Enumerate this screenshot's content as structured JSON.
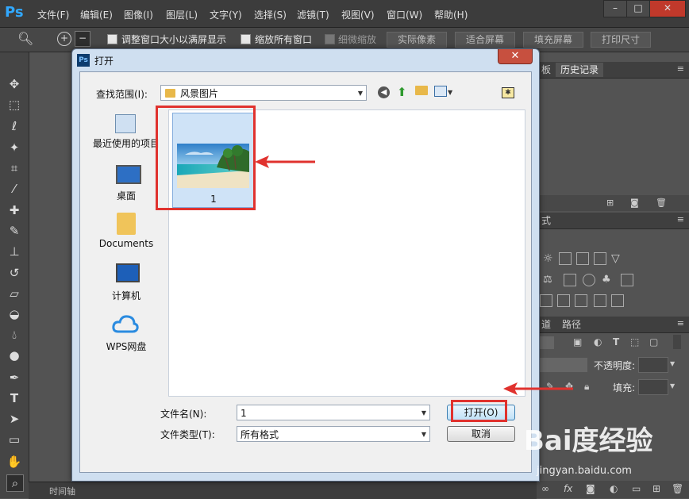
{
  "app": {
    "logo": "Ps"
  },
  "menubar": {
    "items": [
      "文件(F)",
      "编辑(E)",
      "图像(I)",
      "图层(L)",
      "文字(Y)",
      "选择(S)",
      "滤镜(T)",
      "视图(V)",
      "窗口(W)",
      "帮助(H)"
    ]
  },
  "window_buttons": {
    "minimize": "–",
    "restore": "□",
    "close": "✕"
  },
  "options": {
    "resize_window": "调整窗口大小以满屏显示",
    "zoom_all": "缩放所有窗口",
    "scrubby_zoom": "细微缩放",
    "actual_pixels": "实际像素",
    "fit_screen": "适合屏幕",
    "fill_screen": "填充屏幕",
    "print_size": "打印尺寸"
  },
  "panels": {
    "tab_prev": "板",
    "history_tab": "历史记录",
    "adjust_tab": "式",
    "layers_tab1": "道",
    "layers_tab2": "路径",
    "opacity_label": "不透明度:",
    "fill_label": "填充:"
  },
  "status": {
    "timeline": "时间轴"
  },
  "dialog": {
    "title": "打开",
    "look_in_label": "查找范围(I):",
    "look_in_value": "风景图片",
    "places": [
      {
        "label": "最近使用的项目",
        "icon": "recent-items-icon"
      },
      {
        "label": "桌面",
        "icon": "desktop-icon"
      },
      {
        "label": "Documents",
        "icon": "folder-icon"
      },
      {
        "label": "计算机",
        "icon": "computer-icon"
      },
      {
        "label": "WPS网盘",
        "icon": "cloud-icon"
      }
    ],
    "file": {
      "name": "1"
    },
    "filename_label": "文件名(N):",
    "filename_value": "1",
    "filetype_label": "文件类型(T):",
    "filetype_value": "所有格式",
    "open_button": "打开(O)",
    "cancel_button": "取消"
  },
  "watermark": {
    "brand": "Bai度经验",
    "url": "jingyan.baidu.com"
  },
  "colors": {
    "highlight": "#e0322e",
    "ps_blue": "#31a8ff"
  }
}
